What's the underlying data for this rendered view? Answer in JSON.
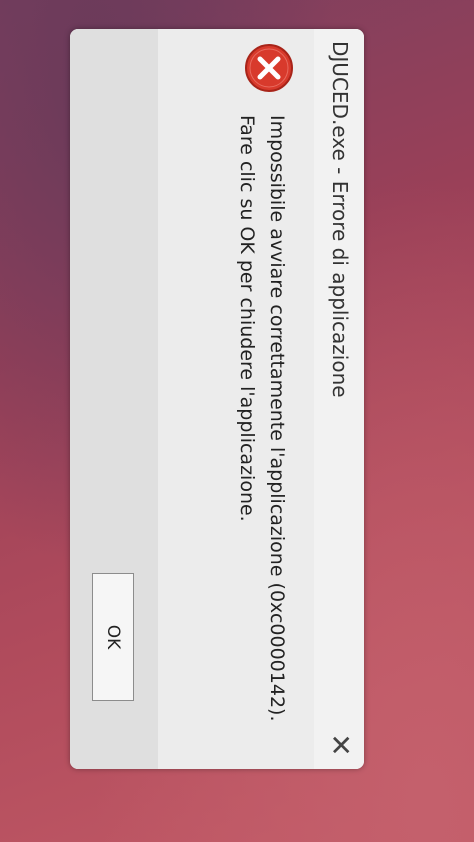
{
  "dialog": {
    "title": "DJUCED.exe - Errore di applicazione",
    "close_icon": "close-icon",
    "icon": "error-icon",
    "message": "Impossibile avviare correttamente l'applicazione (0xc0000142). Fare clic su OK per chiudere l'applicazione.",
    "ok_label": "OK",
    "colors": {
      "background": "#ececec",
      "titlebar": "#f2f2f2",
      "footer": "#dfdfdf",
      "error_icon": "#d83a2c"
    }
  }
}
